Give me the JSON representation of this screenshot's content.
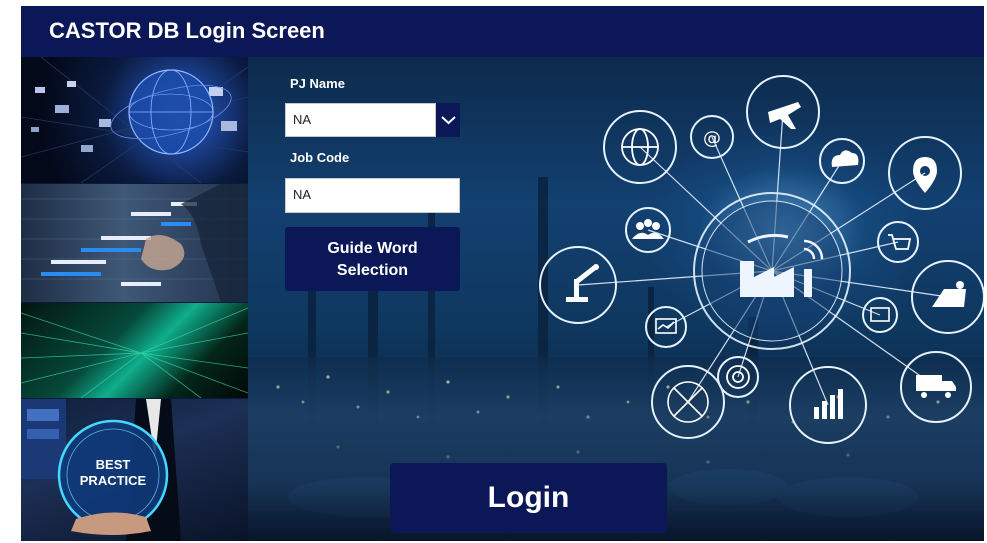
{
  "header": {
    "title": "CASTOR DB Login Screen"
  },
  "form": {
    "pj_name_label": "PJ Name",
    "pj_name_value": "NA",
    "job_code_label": "Job Code",
    "job_code_value": "NA",
    "guide_word_line1": "Guide Word",
    "guide_word_line2": "Selection",
    "login_label": "Login"
  },
  "images": {
    "best_practice_line1": "BEST",
    "best_practice_line2": "PRACTICE"
  },
  "icons": [
    "globe-icon",
    "at-sign-icon",
    "airplane-icon",
    "cloud-icon",
    "location-pin-icon",
    "people-icon",
    "shopping-cart-icon",
    "robot-arm-icon",
    "solar-panel-icon",
    "monitor-chart-icon",
    "envelope-icon",
    "gear-wheel-icon",
    "truck-icon",
    "analytics-circle-icon",
    "bar-chart-icon",
    "factory-icon"
  ]
}
